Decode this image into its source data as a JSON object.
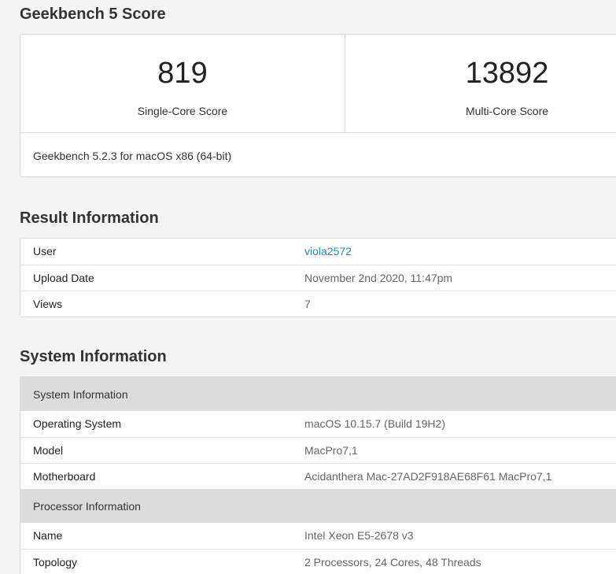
{
  "score_section": {
    "title": "Geekbench 5 Score",
    "single_core": {
      "value": "819",
      "label": "Single-Core Score"
    },
    "multi_core": {
      "value": "13892",
      "label": "Multi-Core Score"
    },
    "version": "Geekbench 5.2.3 for macOS x86 (64-bit)"
  },
  "result_section": {
    "title": "Result Information",
    "rows": [
      {
        "key": "User",
        "value": "viola2572"
      },
      {
        "key": "Upload Date",
        "value": "November 2nd 2020, 11:47pm"
      },
      {
        "key": "Views",
        "value": "7"
      }
    ]
  },
  "system_section": {
    "title": "System Information",
    "groups": [
      {
        "header": "System Information",
        "rows": [
          {
            "key": "Operating System",
            "value": "macOS 10.15.7 (Build 19H2)"
          },
          {
            "key": "Model",
            "value": "MacPro7,1"
          },
          {
            "key": "Motherboard",
            "value": "Acidanthera Mac-27AD2F918AE68F61 MacPro7,1"
          }
        ]
      },
      {
        "header": "Processor Information",
        "rows": [
          {
            "key": "Name",
            "value": "Intel Xeon E5-2678 v3"
          },
          {
            "key": "Topology",
            "value": "2 Processors, 24 Cores, 48 Threads"
          }
        ]
      }
    ]
  },
  "colors": {
    "page_bg": "#f4f4f4",
    "link": "#1a8fb8",
    "group_header_bg": "#dcdcdc"
  }
}
